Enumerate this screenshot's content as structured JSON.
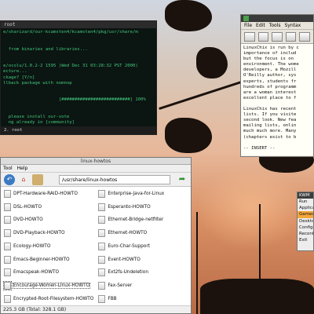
{
  "terminal": {
    "title": "root",
    "lines": [
      "e/sharizard/our-kcamsten4/kcamsten4/pkg/usr/share/m",
      "",
      "",
      "  from binaries and libraries...",
      "",
      "",
      "e/ocolu/1.0.2-2 1595 (Wed Dec 31 03:28:32 PST 2000)",
      "ecture...",
      "ckage? [Y/n]",
      "llback package with nomnop",
      "",
      "",
      "                     [##########################] 100%",
      "",
      "",
      "  please install our-vote",
      "  ng already in [community]"
    ],
    "tabs": [
      "2. root"
    ]
  },
  "vim": {
    "title": "",
    "menu": [
      "File",
      "Edit",
      "Tools",
      "Syntax"
    ],
    "lines": [
      "LinuxChix is run by c",
      "importance of includ",
      "but the focus is on",
      "environment. The wome",
      "developers, a Mozill",
      "O'Reilly author, sys",
      "experts, students fr",
      "hundreds of programm",
      "are a woman interest",
      "excellent place to f",
      "",
      "LinuxChix has recent",
      "lists. If you visite",
      "second look. New fea",
      "mailing lists, onlin",
      "much much more. Many",
      "(chapters exist to b",
      "",
      "-- INSERT --"
    ]
  },
  "file_manager": {
    "title": "linux-howtos",
    "menu": [
      "Tool",
      "Help"
    ],
    "path": "/usr/share/linux-howtos",
    "items_left": [
      "DPT-Hardware-RAID-HOWTO",
      "DSL-HOWTO",
      "DVD-HOWTO",
      "DVD-Playback-HOWTO",
      "Ecology-HOWTO",
      "Emacs-Beginner-HOWTO",
      "Emacspeak-HOWTO",
      "Encourage-Women-Linux-HOWTO",
      "Encrypted-Root-Filesystem-HOWTO"
    ],
    "items_right": [
      "Enterprise-Java-for-Linux",
      "Esperanto-HOWTO",
      "Ethernet-Bridge-netfilter",
      "Ethernet-HOWTO",
      "Euro-Char-Support",
      "Event-HOWTO",
      "Ext2fs-Undeletion",
      "Fax-Server",
      "FBB"
    ],
    "status": "225.3 GB (Total: 328.1 GB)"
  },
  "root_menu": {
    "title": "KWM",
    "items": [
      "Run",
      "Applica",
      "Games",
      "Deskto",
      "Config",
      "Reconf",
      "Exit"
    ],
    "highlighted_index": 2
  },
  "colors": {
    "terminal_text": "#42c77a",
    "terminal_bg": "#0b1512",
    "menu_highlight": "#f4a83c"
  }
}
